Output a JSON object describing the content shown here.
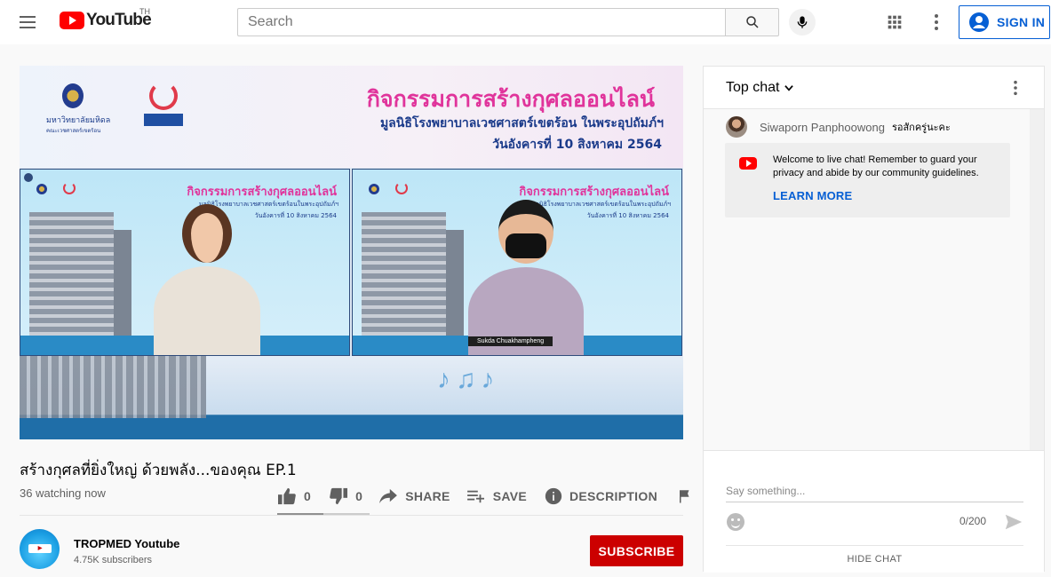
{
  "header": {
    "logo_text": "YouTube",
    "country_code": "TH",
    "search_placeholder": "Search",
    "signin_label": "SIGN IN"
  },
  "player": {
    "banner_title": "กิจกรรมการสร้างกุศลออนไลน์",
    "banner_subtitle": "มูลนิธิโรงพยาบาลเวชศาสตร์เขตร้อน ในพระอุปถัมภ์ฯ",
    "banner_date": "วันอังคารที่ 10 สิงหาคม 2564",
    "university_name": "มหาวิทยาลัยมหิดล",
    "university_sub": "คณะเวชศาสตร์เขตร้อน",
    "pane_title": "กิจกรรมการสร้างกุศลออนไลน์",
    "pane_subtitle": "มูลนิธิโรงพยาบาลเวชศาสตร์เขตร้อนในพระอุปถัมภ์ฯ",
    "pane_date": "วันอังคารที่ 10 สิงหาคม 2564",
    "participant_name": "Sukda Chuakhampheng"
  },
  "video": {
    "title": "สร้างกุศลที่ยิ่งใหญ่ ด้วยพลัง...ของคุณ EP.1",
    "watching": "36 watching now",
    "likes": "0",
    "dislikes": "0",
    "like_ratio": 0.5,
    "share_label": "SHARE",
    "save_label": "SAVE",
    "description_label": "DESCRIPTION"
  },
  "channel": {
    "name": "TROPMED Youtube",
    "subscribers": "4.75K subscribers",
    "subscribe_label": "SUBSCRIBE"
  },
  "chat": {
    "mode_label": "Top chat",
    "messages": [
      {
        "author": "Siwaporn Panphoowong",
        "text": "รอสักครู่นะคะ"
      }
    ],
    "welcome_text": "Welcome to live chat! Remember to guard your privacy and abide by our community guidelines.",
    "learn_more": "LEARN MORE",
    "input_placeholder": "Say something...",
    "char_count": "0/200",
    "hide_chat": "HIDE CHAT"
  },
  "colors": {
    "brand_red": "#ff0000",
    "link_blue": "#065fd4",
    "subscribe_red": "#cc0000"
  }
}
